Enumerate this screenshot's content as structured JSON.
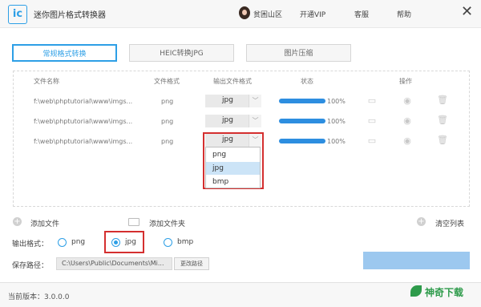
{
  "window": {
    "logo_text": "ic",
    "title": "迷你图片格式转换器",
    "user_name": "贫困山区",
    "nav": [
      "开通VIP",
      "客服",
      "帮助"
    ],
    "close_icon": "close-icon"
  },
  "tabs": [
    {
      "label": "常规格式转换",
      "active": true
    },
    {
      "label": "HEIC转换JPG",
      "active": false
    },
    {
      "label": "图片压缩",
      "active": false
    }
  ],
  "table": {
    "headers": [
      "文件名称",
      "文件格式",
      "输出文件格式",
      "状态",
      "操作"
    ],
    "rows": [
      {
        "file": "f:\\web\\phptutorial\\www\\imgs...",
        "format": "png",
        "output": "jpg",
        "progress": 1.0,
        "status": "100%"
      },
      {
        "file": "f:\\web\\phptutorial\\www\\imgs...",
        "format": "png",
        "output": "jpg",
        "progress": 1.0,
        "status": "100%"
      },
      {
        "file": "f:\\web\\phptutorial\\www\\imgs...",
        "format": "png",
        "output": "jpg",
        "progress": 1.0,
        "status": "100%"
      }
    ],
    "dropdown_options": [
      "png",
      "jpg",
      "bmp"
    ],
    "dropdown_selected": "jpg"
  },
  "actions": {
    "add_file": "添加文件",
    "add_folder": "添加文件夹",
    "clear_list": "清空列表"
  },
  "output": {
    "label": "输出格式：",
    "options": [
      "png",
      "jpg",
      "bmp"
    ],
    "selected": "jpg"
  },
  "save": {
    "label": "保存路径：",
    "path": "C:\\Users\\Public\\Documents\\Mi...",
    "change_button": "更改路径"
  },
  "footer": {
    "version": "当前版本：3.0.0.0",
    "watermark": "神奇下载"
  },
  "colors": {
    "accent": "#2d9fe6",
    "highlight_box": "#d42f2f",
    "progress": "#2d8ee0"
  }
}
